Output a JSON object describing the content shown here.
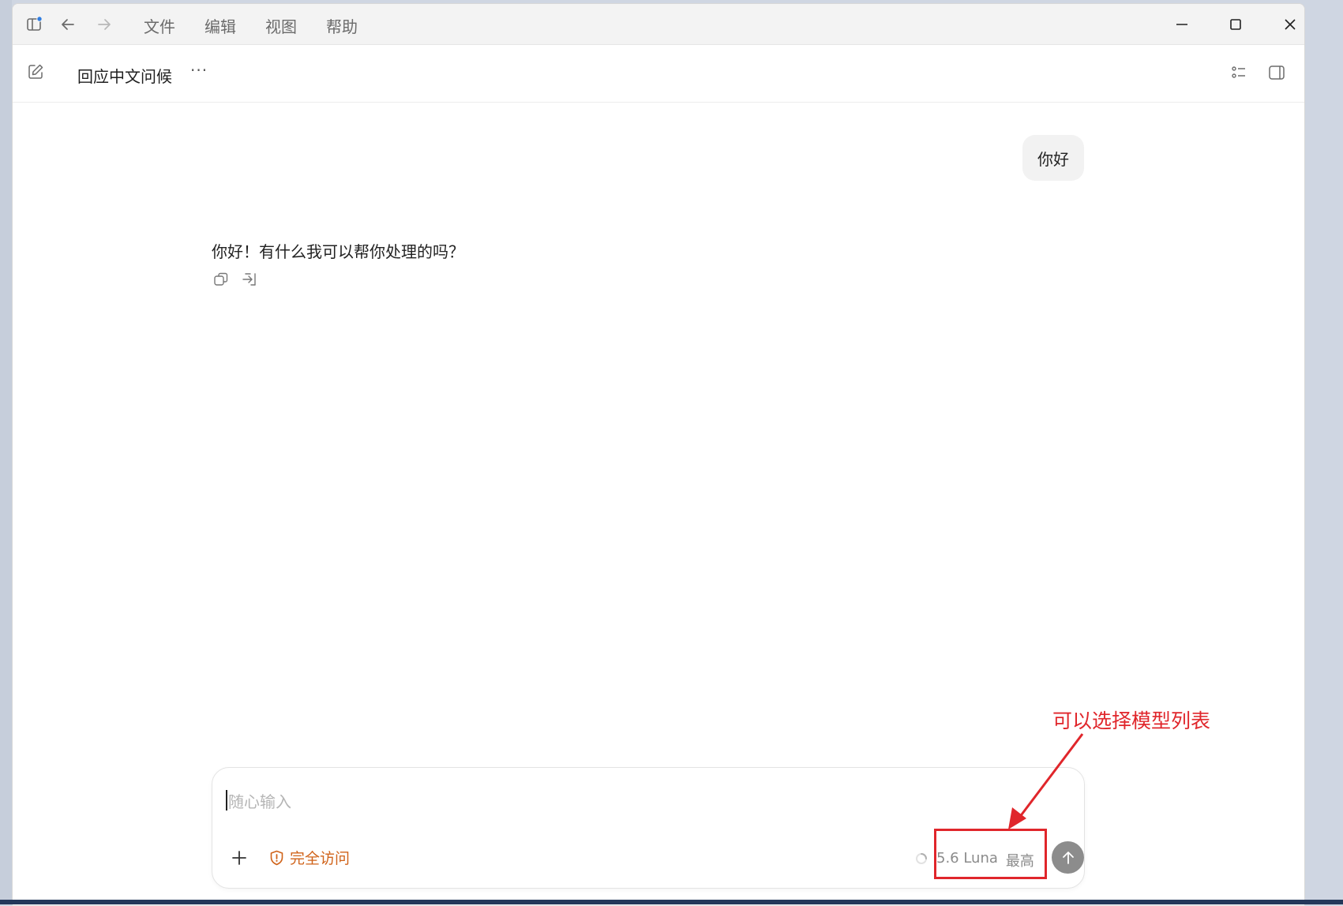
{
  "titlebar": {
    "menu": [
      "文件",
      "编辑",
      "视图",
      "帮助"
    ]
  },
  "header": {
    "title": "回应中文问候",
    "more": "···"
  },
  "conversation": {
    "user_message": "你好",
    "assistant_reply": "你好！有什么我可以帮你处理的吗？"
  },
  "composer": {
    "placeholder": "随心输入",
    "access_label": "完全访问",
    "model_name": "5.6 Luna",
    "effort_label": "最高"
  },
  "annotation": {
    "text": "可以选择模型列表",
    "color": "#e0262b"
  },
  "colors": {
    "accent_orange": "#d0631a",
    "send_button": "#8c8c8c",
    "titlebar_bg": "#f3f3f3"
  }
}
